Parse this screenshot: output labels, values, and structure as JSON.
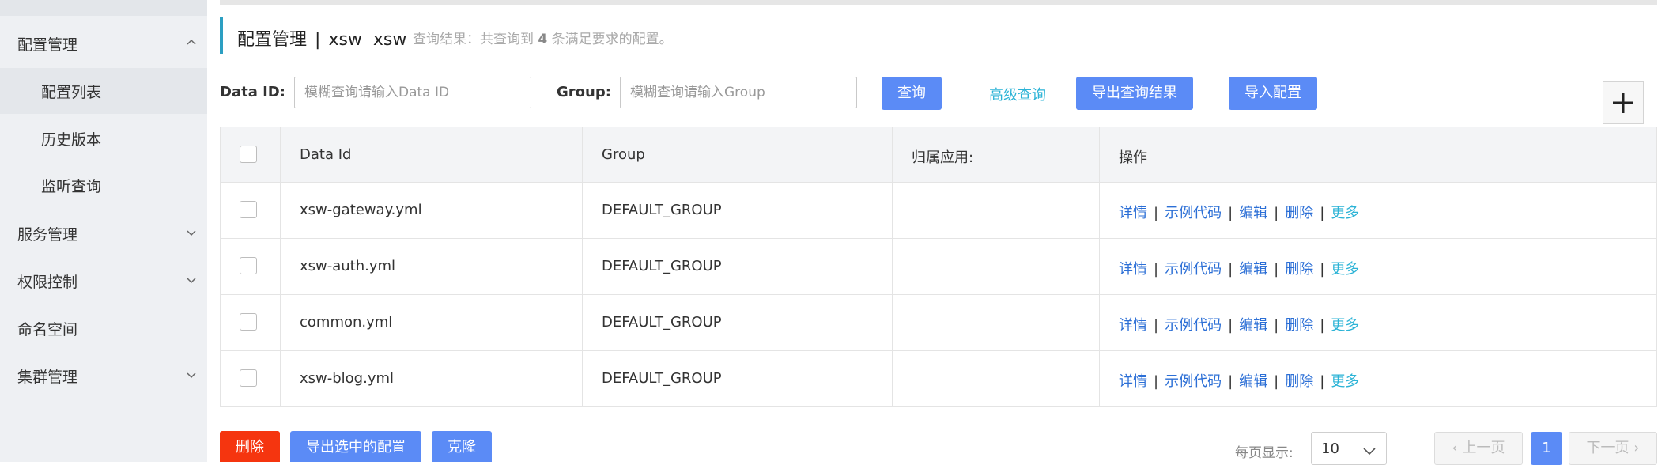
{
  "sidebar": {
    "config_mgmt": "配置管理",
    "config_list": "配置列表",
    "history": "历史版本",
    "listen_query": "监听查询",
    "service_mgmt": "服务管理",
    "access_control": "权限控制",
    "namespace": "命名空间",
    "cluster_mgmt": "集群管理"
  },
  "header": {
    "title": "配置管理",
    "separator": "|",
    "namespace": "xsw  xsw",
    "result_prefix": "查询结果：共查询到",
    "result_count": "4",
    "result_suffix": "条满足要求的配置。"
  },
  "filters": {
    "data_id_label": "Data ID:",
    "data_id_placeholder": "模糊查询请输入Data ID",
    "group_label": "Group:",
    "group_placeholder": "模糊查询请输入Group",
    "query_button": "查询",
    "advanced_query": "高级查询",
    "export_results": "导出查询结果",
    "import_config": "导入配置"
  },
  "table": {
    "headers": {
      "data_id": "Data Id",
      "group": "Group",
      "app": "归属应用:",
      "ops": "操作"
    },
    "rows": [
      {
        "data_id": "xsw-gateway.yml",
        "group": "DEFAULT_GROUP",
        "app": ""
      },
      {
        "data_id": "xsw-auth.yml",
        "group": "DEFAULT_GROUP",
        "app": ""
      },
      {
        "data_id": "common.yml",
        "group": "DEFAULT_GROUP",
        "app": ""
      },
      {
        "data_id": "xsw-blog.yml",
        "group": "DEFAULT_GROUP",
        "app": ""
      }
    ],
    "ops": {
      "detail": "详情",
      "sample": "示例代码",
      "edit": "编辑",
      "delete": "删除",
      "more": "更多",
      "sep": "|"
    }
  },
  "footer": {
    "delete": "删除",
    "export_selected": "导出选中的配置",
    "clone": "克隆",
    "page_size_label": "每页显示:",
    "page_size": "10",
    "prev": "上一页",
    "page": "1",
    "next": "下一页"
  },
  "colors": {
    "primary": "#5b8bf6",
    "danger": "#f5350f",
    "link": "#2c6fd6",
    "accent": "#2bb3d6"
  }
}
